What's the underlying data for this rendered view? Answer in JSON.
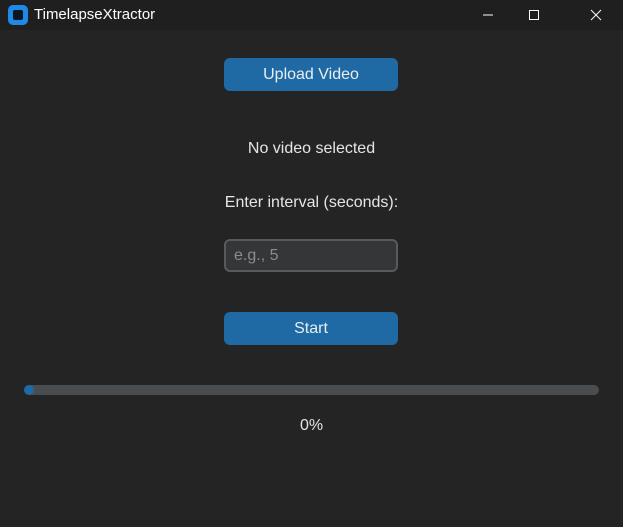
{
  "window": {
    "title": "TimelapseXtractor"
  },
  "main": {
    "upload_button_label": "Upload Video",
    "status_text": "No video selected",
    "interval_label": "Enter interval (seconds):",
    "interval_input": {
      "value": "",
      "placeholder": "e.g., 5"
    },
    "start_button_label": "Start",
    "progress": {
      "fraction": 0.0,
      "label": "0%"
    }
  },
  "colors": {
    "background": "#242424",
    "accent": "#1f6aa5",
    "input_background": "#343638",
    "progress_track": "#4a4d50"
  },
  "icons": {
    "app": "app-icon",
    "minimize": "minimize-icon",
    "maximize": "maximize-icon",
    "close": "close-icon"
  }
}
